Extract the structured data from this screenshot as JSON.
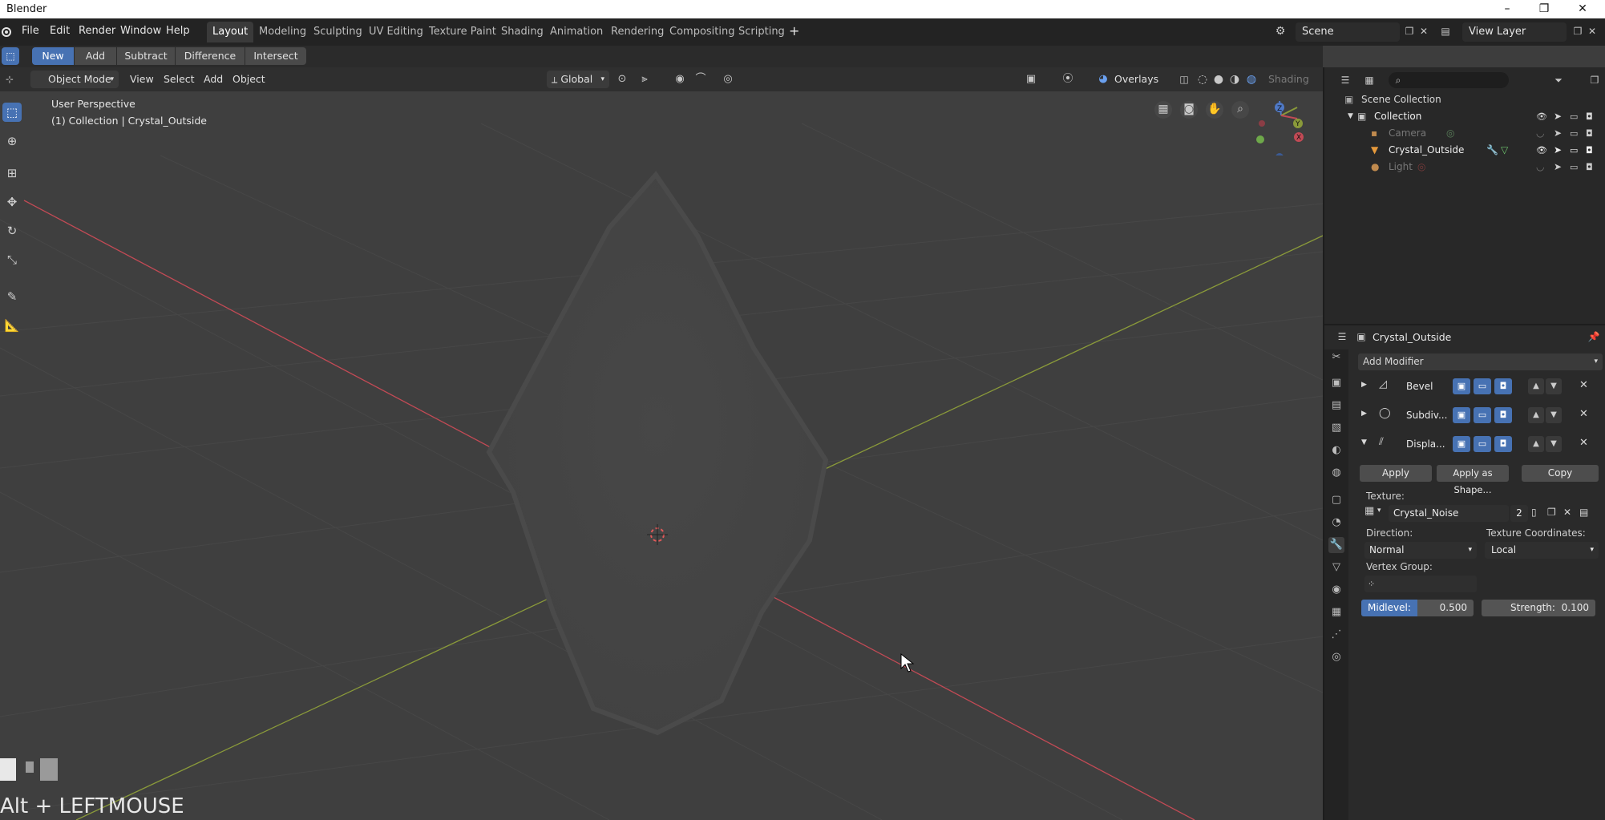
{
  "window": {
    "title": "Blender",
    "minimize": "–",
    "maximize": "❐",
    "close": "✕"
  },
  "menu": {
    "file": "File",
    "edit": "Edit",
    "render": "Render",
    "window": "Window",
    "help": "Help"
  },
  "workspaces": [
    "Layout",
    "Modeling",
    "Sculpting",
    "UV Editing",
    "Texture Paint",
    "Shading",
    "Animation",
    "Rendering",
    "Compositing",
    "Scripting"
  ],
  "add_workspace": "+",
  "scene": {
    "name": "Scene",
    "view_layer": "View Layer"
  },
  "boolean_tools": {
    "new": "New",
    "add": "Add",
    "subtract": "Subtract",
    "difference": "Difference",
    "intersect": "Intersect"
  },
  "viewport_header": {
    "mode": "Object Mode",
    "view": "View",
    "select": "Select",
    "add": "Add",
    "object": "Object",
    "orientation": "Global",
    "overlays": "Overlays",
    "shading": "Shading"
  },
  "viewport": {
    "perspective": "User Perspective",
    "collection_info": "(1) Collection | Crystal_Outside",
    "gizmo_x": "X",
    "gizmo_y": "Y",
    "gizmo_z": "Z",
    "key_display": "Alt + LEFTMOUSE"
  },
  "outliner": {
    "scene_collection": "Scene Collection",
    "collection": "Collection",
    "items": [
      "Camera",
      "Crystal_Outside",
      "Light"
    ]
  },
  "properties": {
    "object_name": "Crystal_Outside",
    "add_modifier": "Add Modifier",
    "modifiers": [
      "Bevel",
      "Subdiv...",
      "Displa..."
    ],
    "apply": "Apply",
    "apply_as_shape": "Apply as Shape...",
    "copy": "Copy",
    "texture_label": "Texture:",
    "texture_name": "Crystal_Noise",
    "texture_users": "2",
    "direction_label": "Direction:",
    "direction_value": "Normal",
    "texcoords_label": "Texture Coordinates:",
    "texcoords_value": "Local",
    "vertex_group_label": "Vertex Group:",
    "midlevel_label": "Midlevel:",
    "midlevel_value": "0.500",
    "strength_label": "Strength:",
    "strength_value": "0.100"
  },
  "colors": {
    "accent": "#4772b3",
    "x_axis": "#c24a55",
    "y_axis": "#8a9a3a",
    "background": "#3f3f3f"
  }
}
